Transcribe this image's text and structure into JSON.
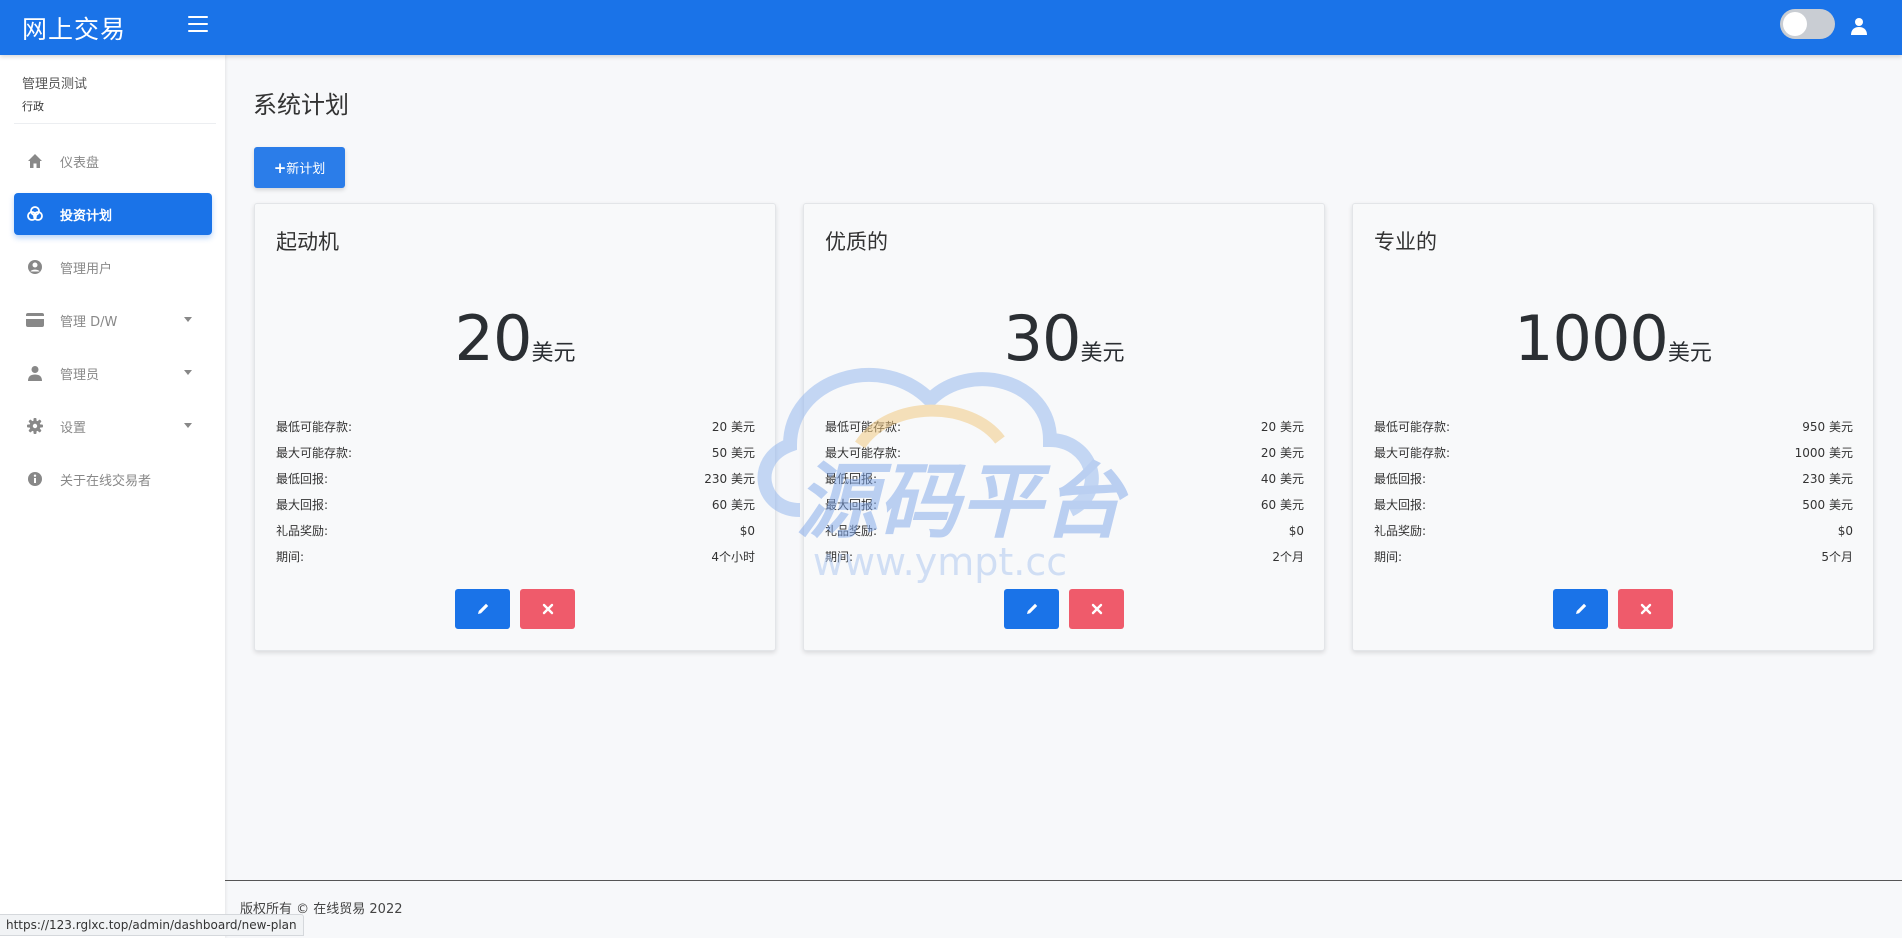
{
  "header": {
    "brand": "网上交易"
  },
  "sidebar": {
    "user_name": "管理员测试",
    "user_role": "行政",
    "items": [
      {
        "label": "仪表盘",
        "icon": "home-icon",
        "active": false,
        "has_caret": false
      },
      {
        "label": "投资计划",
        "icon": "coins-icon",
        "active": true,
        "has_caret": false
      },
      {
        "label": "管理用户",
        "icon": "user-circle-icon",
        "active": false,
        "has_caret": false
      },
      {
        "label": "管理 D/W",
        "icon": "credit-card-icon",
        "active": false,
        "has_caret": true
      },
      {
        "label": "管理员",
        "icon": "user-icon",
        "active": false,
        "has_caret": true
      },
      {
        "label": "设置",
        "icon": "gear-icon",
        "active": false,
        "has_caret": true
      },
      {
        "label": "关于在线交易者",
        "icon": "info-icon",
        "active": false,
        "has_caret": false
      }
    ]
  },
  "main": {
    "title": "系统计划",
    "new_plan_label": "新计划",
    "plans": [
      {
        "name": "起动机",
        "price": "20",
        "unit": "美元",
        "rows": [
          {
            "label": "最低可能存款:",
            "value": "20 美元"
          },
          {
            "label": "最大可能存款:",
            "value": "50 美元"
          },
          {
            "label": "最低回报:",
            "value": "230 美元"
          },
          {
            "label": "最大回报:",
            "value": "60 美元"
          },
          {
            "label": "礼品奖励:",
            "value": "$0"
          },
          {
            "label": "期间:",
            "value": "4个小时"
          }
        ]
      },
      {
        "name": "优质的",
        "price": "30",
        "unit": "美元",
        "rows": [
          {
            "label": "最低可能存款:",
            "value": "20 美元"
          },
          {
            "label": "最大可能存款:",
            "value": "20 美元"
          },
          {
            "label": "最低回报:",
            "value": "40 美元"
          },
          {
            "label": "最大回报:",
            "value": "60 美元"
          },
          {
            "label": "礼品奖励:",
            "value": "$0"
          },
          {
            "label": "期间:",
            "value": "2个月"
          }
        ]
      },
      {
        "name": "专业的",
        "price": "1000",
        "unit": "美元",
        "rows": [
          {
            "label": "最低可能存款:",
            "value": "950 美元"
          },
          {
            "label": "最大可能存款:",
            "value": "1000 美元"
          },
          {
            "label": "最低回报:",
            "value": "230 美元"
          },
          {
            "label": "最大回报:",
            "value": "500 美元"
          },
          {
            "label": "礼品奖励:",
            "value": "$0"
          },
          {
            "label": "期间:",
            "value": "5个月"
          }
        ]
      }
    ]
  },
  "watermark": {
    "line1": "源码平台",
    "line2": "www.ympt.cc"
  },
  "footer": {
    "text": "版权所有 © 在线贸易 2022"
  },
  "statusbar": {
    "url": "https://123.rglxc.top/admin/dashboard/new-plan"
  },
  "colors": {
    "primary": "#1a73e8",
    "danger": "#ef5b6b",
    "background": "#f7f8fa"
  }
}
